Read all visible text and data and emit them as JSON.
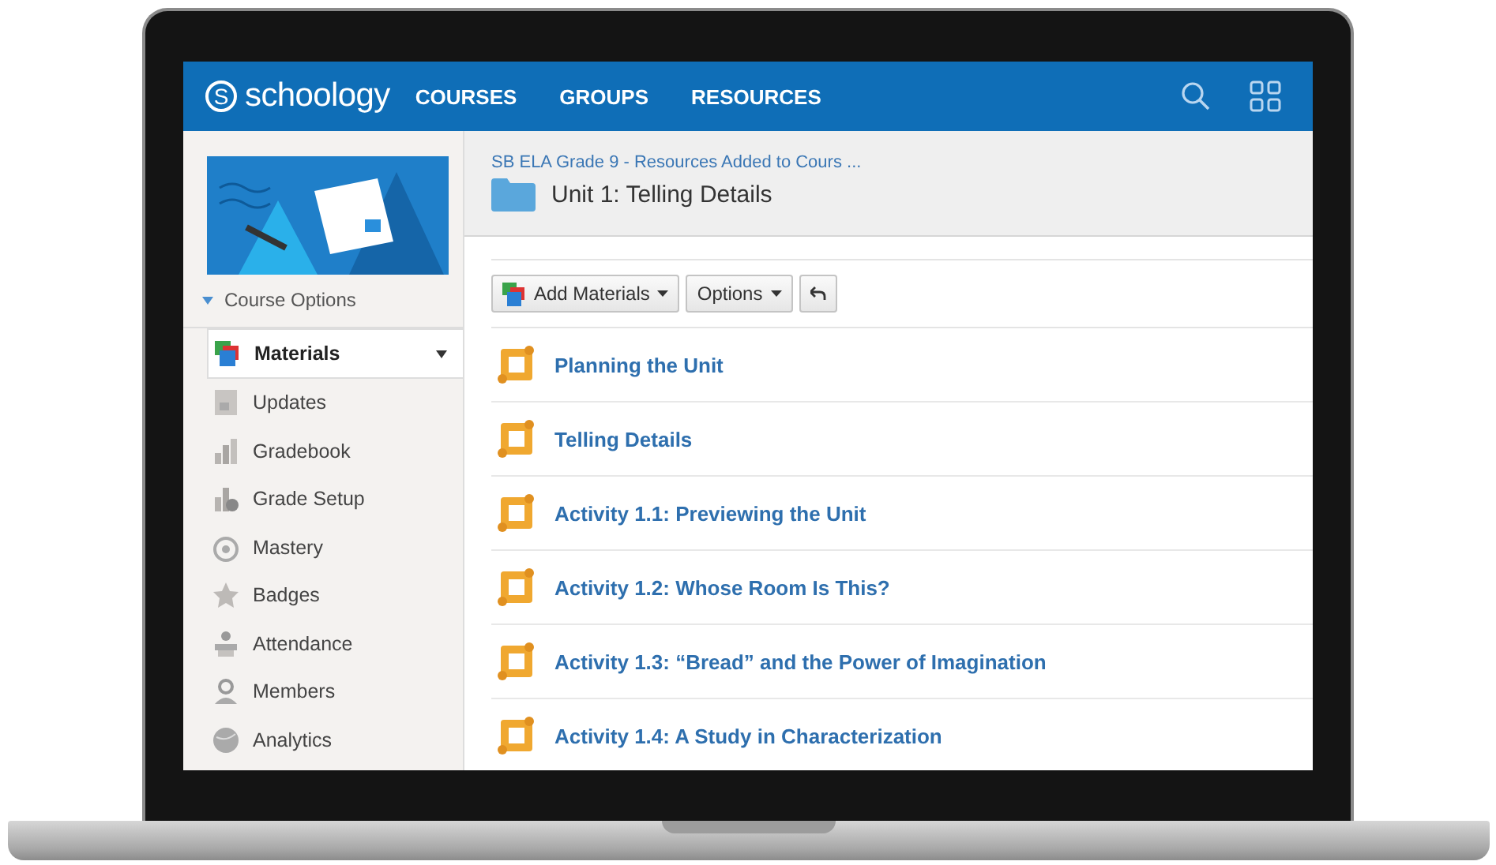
{
  "navbar": {
    "logo_text": "schoology",
    "logo_mark": "S",
    "nav_links": [
      {
        "label": "COURSES"
      },
      {
        "label": "GROUPS"
      },
      {
        "label": "RESOURCES"
      }
    ]
  },
  "sidebar": {
    "course_options": "Course Options",
    "items": [
      {
        "label": "Materials",
        "selected": true
      },
      {
        "label": "Updates",
        "selected": false
      },
      {
        "label": "Gradebook",
        "selected": false
      },
      {
        "label": "Grade Setup",
        "selected": false
      },
      {
        "label": "Mastery",
        "selected": false
      },
      {
        "label": "Badges",
        "selected": false
      },
      {
        "label": "Attendance",
        "selected": false
      },
      {
        "label": "Members",
        "selected": false
      },
      {
        "label": "Analytics",
        "selected": false
      }
    ]
  },
  "header": {
    "breadcrumb": "SB ELA Grade 9 - Resources Added to Cours ...",
    "title": "Unit 1: Telling Details"
  },
  "toolbar": {
    "buttons": [
      {
        "label": "Add Materials"
      },
      {
        "label": "Options"
      }
    ]
  },
  "materials": [
    {
      "title": "Planning the Unit"
    },
    {
      "title": "Telling Details"
    },
    {
      "title": "Activity 1.1: Previewing the Unit"
    },
    {
      "title": "Activity 1.2: Whose Room Is This?"
    },
    {
      "title": "Activity 1.3: “Bread” and the Power of Imagination"
    },
    {
      "title": "Activity 1.4: A Study in Characterization"
    }
  ]
}
